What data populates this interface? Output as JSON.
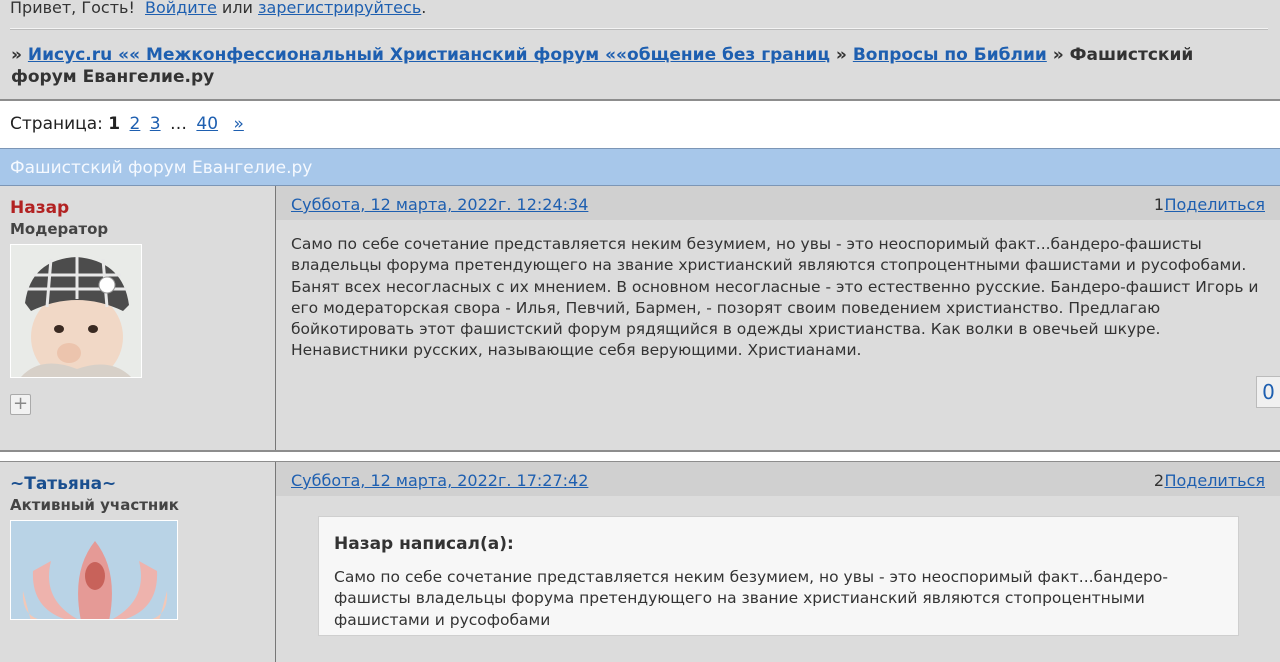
{
  "header": {
    "greeting": "Привет, Гость!",
    "login_link": "Войдите",
    "or_text": "или",
    "register_link": "зарегистрируйтесь",
    "register_dot": ".",
    "breadcrumbs": {
      "sep": "»",
      "forum": "Иисус.ru «« Межконфессиональный Христианский форум ««общение без границ",
      "section": "Вопросы по Библии",
      "current": "Фашистский форум Евангелие.ру"
    }
  },
  "pager": {
    "label": "Страница:",
    "current": "1",
    "pages": [
      "2",
      "3"
    ],
    "ellipsis": "…",
    "last": "40",
    "next": "»"
  },
  "topic": {
    "title": "Фашистский форум Евангелие.ру"
  },
  "posts": [
    {
      "author": "Назар",
      "role": "Модератор",
      "date": "Суббота, 12 марта, 2022г. 12:24:34",
      "number": "1",
      "share": "Поделиться",
      "text": "Само по себе сочетание представляется неким безумием, но увы - это неоспоримый факт...бандеро-фашисты владельцы форума претендующего на звание христианский являются стопроцентными фашистами и русофобами. Банят всех несогласных с их мнением. В основном несогласные - это естественно русские. Бандеро-фашист Игорь и его модераторская свора - Илья, Певчий, Бармен, - позорят своим поведением христианство.  Предлагаю бойкотировать этот фашистский форум рядящийся в одежды христианства. Как волки в овечьей шкуре. Ненавистники русских, называющие себя верующими. Христианами.",
      "rating": "0"
    },
    {
      "author": "~Татьяна~",
      "role": "Активный участник",
      "date": "Суббота, 12 марта, 2022г. 17:27:42",
      "number": "2",
      "share": "Поделиться",
      "quote_title": "Назар написал(а):",
      "quote_text": "Само по себе сочетание представляется неким безумием, но увы - это неоспоримый факт...бандеро-фашисты владельцы форума претендующего на звание христианский являются стопроцентными фашистами и русофобами"
    }
  ]
}
